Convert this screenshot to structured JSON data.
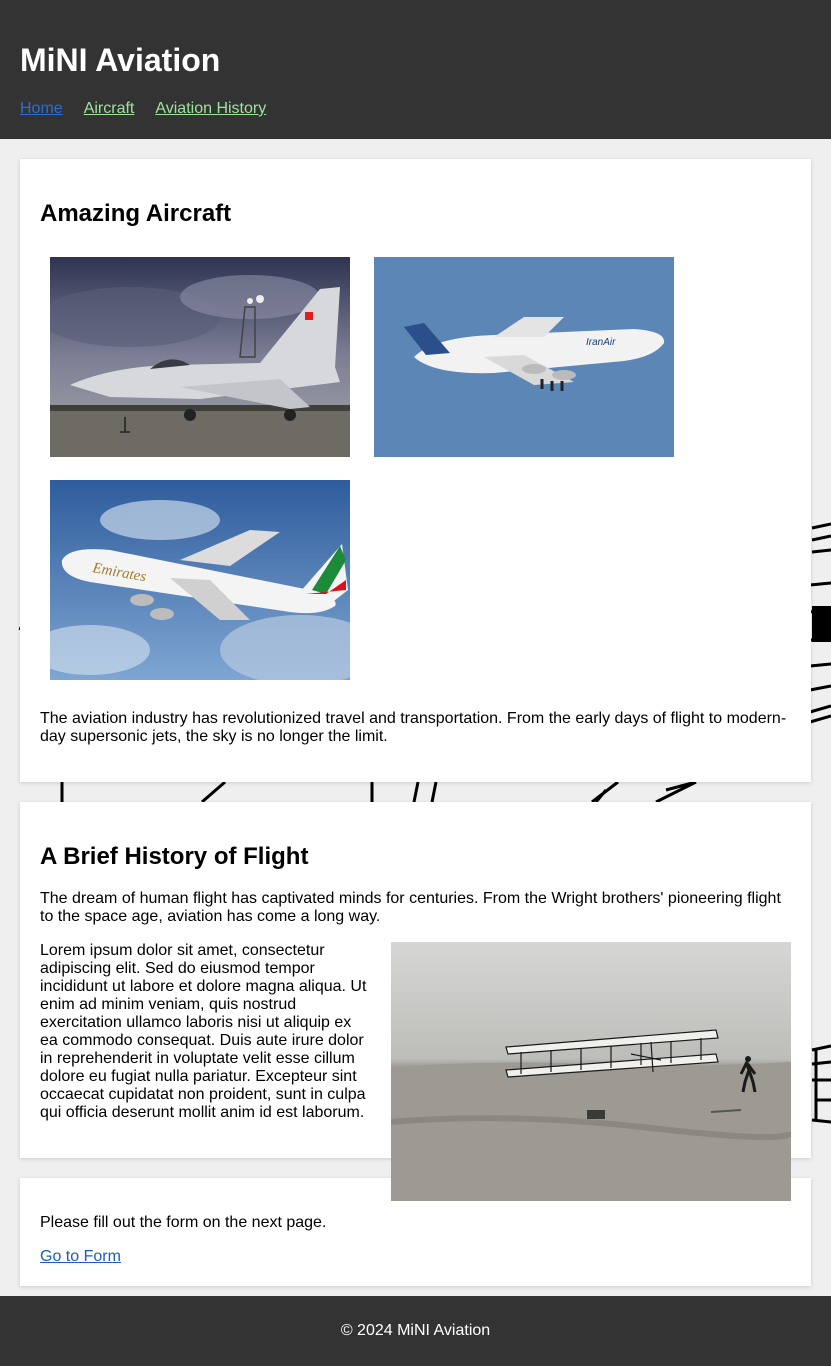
{
  "site": {
    "title": "MiNI Aviation"
  },
  "nav": {
    "items": [
      {
        "label": "Home"
      },
      {
        "label": "Aircraft"
      },
      {
        "label": "Aviation History"
      }
    ]
  },
  "aircraft": {
    "heading": "Amazing Aircraft",
    "images": [
      {
        "subject": "fighter jet on tarmac"
      },
      {
        "subject": "Iran Air jumbo jet in flight",
        "livery_text": "IranAir"
      },
      {
        "subject": "Emirates airliner in flight",
        "livery_text": "Emirates"
      }
    ],
    "description": "The aviation industry has revolutionized travel and transportation. From the early days of flight to modern-day supersonic jets, the sky is no longer the limit."
  },
  "history": {
    "heading": "A Brief History of Flight",
    "intro": "The dream of human flight has captivated minds for centuries. From the Wright brothers' pioneering flight to the space age, aviation has come a long way.",
    "body": "Lorem ipsum dolor sit amet, consectetur adipiscing elit. Sed do eiusmod tempor incididunt ut labore et dolore magna aliqua. Ut enim ad minim veniam, quis nostrud exercitation ullamco laboris nisi ut aliquip ex ea commodo consequat. Duis aute irure dolor in reprehenderit in voluptate velit esse cillum dolore eu fugiat nulla pariatur. Excepteur sint occaecat cupidatat non proident, sunt in culpa qui officia deserunt mollit anim id est laborum.",
    "image": {
      "subject": "early biplane flight photo"
    }
  },
  "form_section": {
    "text": "Please fill out the form on the next page.",
    "link_label": "Go to Form"
  },
  "footer": {
    "text": "© 2024 MiNI Aviation"
  },
  "colors": {
    "header_bg": "#333333",
    "page_bg": "#efefef",
    "nav_active": "#2a6fd4",
    "nav_link": "#9ee59b",
    "link": "#1a5fb4"
  }
}
